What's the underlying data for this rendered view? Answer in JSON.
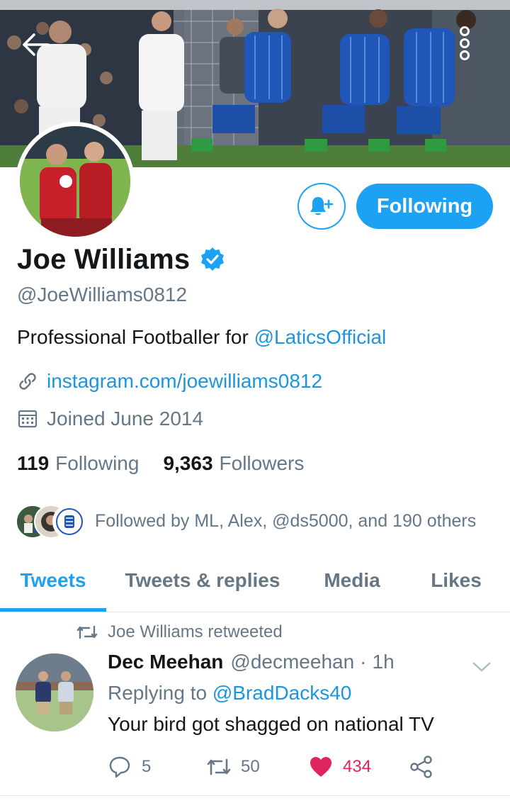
{
  "header": {
    "back_icon": "arrow-left-icon",
    "more_icon": "more-vertical-icon"
  },
  "profile": {
    "display_name": "Joe Williams",
    "verified": true,
    "handle": "@JoeWilliams0812",
    "bio_prefix": "Professional Footballer for ",
    "bio_mention": "@LaticsOfficial",
    "link": "instagram.com/joewilliams0812",
    "joined": "Joined June 2014",
    "following_count": "119",
    "following_label": "Following",
    "followers_count": "9,363",
    "followers_label": "Followers",
    "followed_by": "Followed by ML, Alex, @ds5000, and 190 others",
    "follow_button_label": "Following"
  },
  "tabs": [
    {
      "label": "Tweets",
      "active": true
    },
    {
      "label": "Tweets & replies",
      "active": false
    },
    {
      "label": "Media",
      "active": false
    },
    {
      "label": "Likes",
      "active": false
    }
  ],
  "tweet": {
    "retweeted_by": "Joe Williams retweeted",
    "author_name": "Dec Meehan",
    "author_handle": "@decmeehan",
    "separator": "·",
    "time": "1h",
    "replying_prefix": "Replying to ",
    "replying_mention": "@BradDacks40",
    "text": "Your bird got shagged on national TV",
    "reply_count": "5",
    "retweet_count": "50",
    "like_count": "434"
  },
  "colors": {
    "accent": "#1da1f2",
    "link": "#1b95e0",
    "secondary_text": "#657786",
    "like": "#e0245e"
  }
}
